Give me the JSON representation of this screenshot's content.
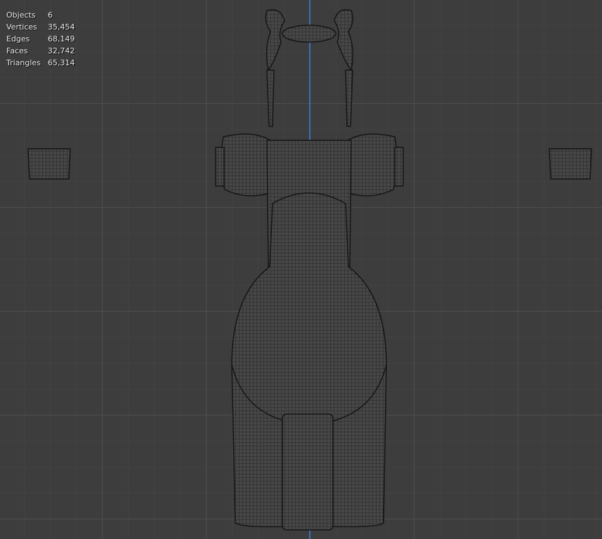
{
  "stats": [
    {
      "label": "Objects",
      "value": "6"
    },
    {
      "label": "Vertices",
      "value": "35,454"
    },
    {
      "label": "Edges",
      "value": "68,149"
    },
    {
      "label": "Faces",
      "value": "32,742"
    },
    {
      "label": "Triangles",
      "value": "65,314"
    }
  ],
  "colors": {
    "background": "#3d3d3d",
    "grid": "#505050",
    "y_axis": "#3f6fb5",
    "wire": "#1a1a1a",
    "mesh_fill": "#474747"
  }
}
